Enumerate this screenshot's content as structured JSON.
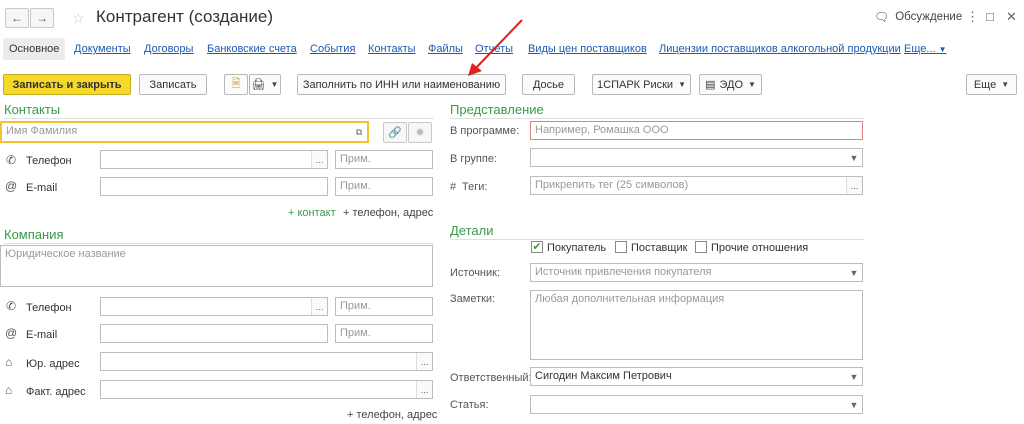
{
  "window": {
    "title": "Контрагент (создание)",
    "discussion_label": "Обсуждение"
  },
  "tabs": [
    "Основное",
    "Документы",
    "Договоры",
    "Банковские счета",
    "События",
    "Контакты",
    "Файлы",
    "Отчеты",
    "Виды цен поставщиков",
    "Лицензии поставщиков алкогольной продукции",
    "Еще..."
  ],
  "toolbar": {
    "save_close": "Записать и закрыть",
    "save": "Записать",
    "fill_inn": "Заполнить по ИНН или наименованию",
    "dossier": "Досье",
    "spark": "1СПАРК Риски",
    "edo": "ЭДО",
    "more": "Еще"
  },
  "contacts": {
    "title": "Контакты",
    "name_placeholder": "Имя Фамилия",
    "phone_label": "Телефон",
    "email_label": "E-mail",
    "note_placeholder": "Прим.",
    "add_contact": "+ контакт",
    "add_phone_address": "+ телефон, адрес"
  },
  "company": {
    "title": "Компания",
    "legal_name_placeholder": "Юридическое название",
    "phone_label": "Телефон",
    "email_label": "E-mail",
    "legal_address_label": "Юр. адрес",
    "actual_address_label": "Факт. адрес",
    "note_placeholder": "Прим.",
    "add_phone_address": "+ телефон, адрес"
  },
  "representation": {
    "title": "Представление",
    "in_program_label": "В программе:",
    "in_program_placeholder": "Например, Ромашка ООО",
    "in_group_label": "В группе:",
    "tags_label": "Теги:",
    "tags_placeholder": "Прикрепить тег (25 символов)"
  },
  "details": {
    "title": "Детали",
    "buyer": "Покупатель",
    "buyer_checked": true,
    "supplier": "Поставщик",
    "other": "Прочие отношения",
    "source_label": "Источник:",
    "source_placeholder": "Источник привлечения покупателя",
    "notes_label": "Заметки:",
    "notes_placeholder": "Любая дополнительная информация",
    "responsible_label": "Ответственный:",
    "responsible_value": "Сигодин Максим Петрович",
    "article_label": "Статья:"
  },
  "colors": {
    "accent_green": "#3a9a48",
    "primary_yellow": "#f5d82a",
    "link_blue": "#1c5ab0",
    "annotation_red": "#e02020"
  },
  "icons": [
    "back-arrow-icon",
    "forward-arrow-icon",
    "discussion-icon",
    "kebab-menu-icon",
    "maximize-icon",
    "close-icon",
    "phone-icon",
    "email-icon",
    "home-icon",
    "link-icon",
    "unlink-icon",
    "printer-icon",
    "document-icon"
  ]
}
